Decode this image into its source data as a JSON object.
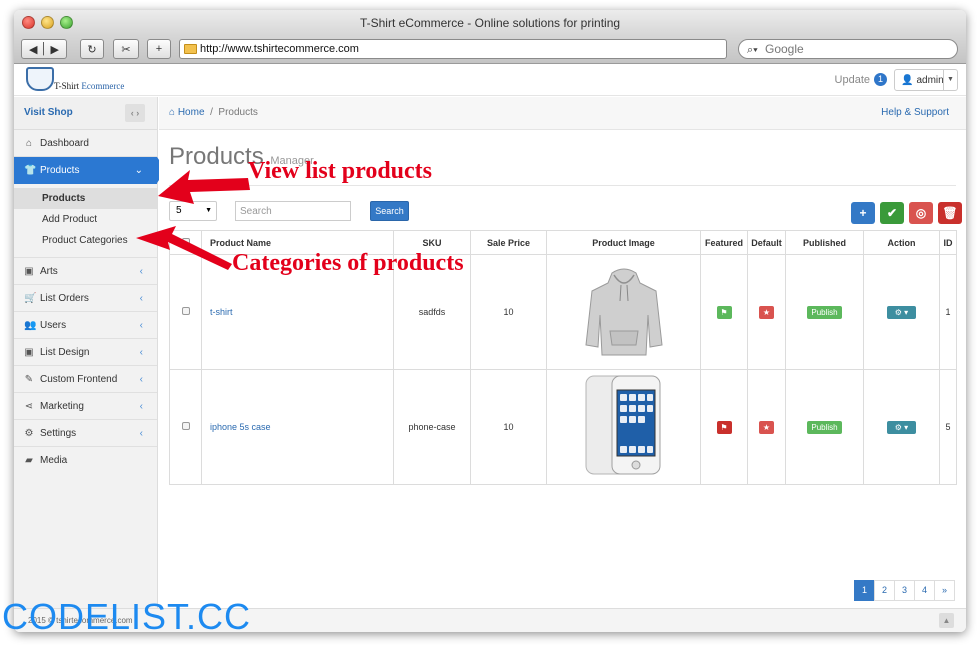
{
  "window": {
    "title": "T-Shirt eCommerce - Online solutions for printing"
  },
  "browser": {
    "url": "http://www.tshirtecommerce.com",
    "search_placeholder": "Google"
  },
  "header": {
    "logo_text_1": "T-Shirt",
    "logo_text_2": "Ecommerce",
    "update_label": "Update",
    "update_count": "1",
    "user_label": "admin"
  },
  "sidebar": {
    "visit_shop": "Visit Shop",
    "items": [
      {
        "label": "Dashboard",
        "icon": "home-icon"
      },
      {
        "label": "Products",
        "icon": "tshirt-icon"
      },
      {
        "label": "Arts",
        "icon": "picture-icon"
      },
      {
        "label": "List Orders",
        "icon": "cart-icon"
      },
      {
        "label": "Users",
        "icon": "users-icon"
      },
      {
        "label": "List Design",
        "icon": "picture-icon"
      },
      {
        "label": "Custom Frontend",
        "icon": "pencil-icon"
      },
      {
        "label": "Marketing",
        "icon": "share-icon"
      },
      {
        "label": "Settings",
        "icon": "gear-icon"
      },
      {
        "label": "Media",
        "icon": "folder-icon"
      }
    ],
    "products_sub": [
      "Products",
      "Add Product",
      "Product Categories"
    ]
  },
  "breadcrumb": {
    "home": "Home",
    "current": "Products",
    "help": "Help & Support"
  },
  "page": {
    "title": "Products",
    "subtitle": "Manager"
  },
  "filters": {
    "per_page": "5",
    "search_placeholder": "Search",
    "search_button": "Search"
  },
  "actions": {
    "colors": {
      "add": "#3479c6",
      "publish": "#3a9a3a",
      "unpublish": "#d9534f",
      "delete": "#c9302c"
    }
  },
  "table": {
    "headers": [
      "Product Name",
      "SKU",
      "Sale Price",
      "Product Image",
      "Featured",
      "Default",
      "Published",
      "Action",
      "ID"
    ],
    "rows": [
      {
        "name": "t-shirt",
        "sku": "sadfds",
        "price": "10",
        "image": "hoodie",
        "featured": "on",
        "published": "Publish",
        "id": "1"
      },
      {
        "name": "iphone 5s case",
        "sku": "phone-case",
        "price": "10",
        "image": "phone-case",
        "featured": "off",
        "published": "Publish",
        "id": "5"
      }
    ]
  },
  "pagination": {
    "pages": [
      "1",
      "2",
      "3",
      "4",
      "»"
    ],
    "active": "1"
  },
  "footer": {
    "text": "2015 © tshirtecommerce.com"
  },
  "annotations": {
    "view_list": "View list products",
    "categories": "Categories of products"
  },
  "watermark": "CODELIST.CC"
}
